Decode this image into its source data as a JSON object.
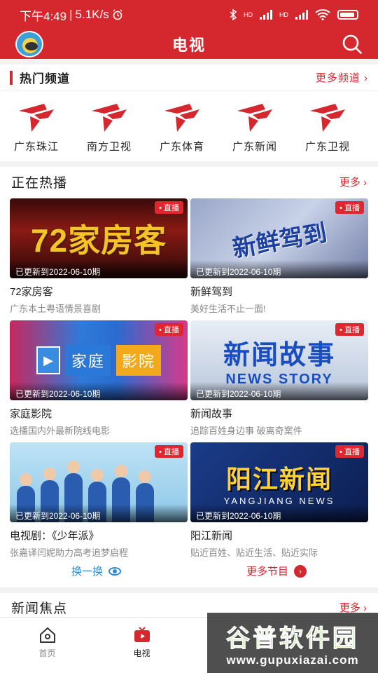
{
  "status_bar": {
    "time": "下午4:49",
    "separator": "|",
    "speed": "5.1K/s",
    "signal_1": "HD",
    "signal_2": "HD"
  },
  "header": {
    "title": "电视"
  },
  "channels_section": {
    "title": "热门频道",
    "more": "更多频道 ›",
    "items": [
      {
        "label": "广东珠江"
      },
      {
        "label": "南方卫视"
      },
      {
        "label": "广东体育"
      },
      {
        "label": "广东新闻"
      },
      {
        "label": "广东卫视"
      }
    ]
  },
  "hot_section": {
    "title": "正在热播",
    "more": "更多 ›",
    "programs": [
      {
        "name": "72家房客",
        "desc": "广东本土粤语情景喜剧",
        "badge": "• 直播",
        "update": "已更新到2022-06-10期",
        "art": "72家房客"
      },
      {
        "name": "新鲜驾到",
        "desc": "美好生活不止一面!",
        "badge": "• 直播",
        "update": "已更新到2022-06-10期",
        "art": "新鲜驾到"
      },
      {
        "name": "家庭影院",
        "desc": "选播国内外最新院线电影",
        "badge": "• 直播",
        "update": "已更新到2022-06-10期",
        "art_1": "家庭",
        "art_2": "影院"
      },
      {
        "name": "新闻故事",
        "desc": "追踪百姓身边事 破离奇案件",
        "badge": "• 直播",
        "update": "已更新到2022-06-10期",
        "art_cn": "新闻故事",
        "art_en": "NEWS STORY"
      },
      {
        "name": "电视剧：《少年派》",
        "desc": "张嘉译闫妮助力高考追梦启程",
        "badge": "• 直播",
        "update": "已更新到2022-06-10期"
      },
      {
        "name": "阳江新闻",
        "desc": "贴近百姓、贴近生活、贴近实际",
        "badge": "• 直播",
        "update": "已更新到2022-06-10期",
        "art_cn": "阳江新闻",
        "art_en": "YANGJIANG NEWS"
      }
    ],
    "swap_label": "换一换",
    "more_programs_label": "更多节目"
  },
  "news_section": {
    "title": "新闻焦点",
    "more": "更多 ›"
  },
  "tabbar": {
    "home": "首页",
    "tv": "电视"
  },
  "watermark": {
    "line1": "谷普软件园",
    "line2": "www.gupuxiazai.com"
  },
  "colors": {
    "brand_red": "#d4272e",
    "link_blue": "#2a8ad6"
  }
}
